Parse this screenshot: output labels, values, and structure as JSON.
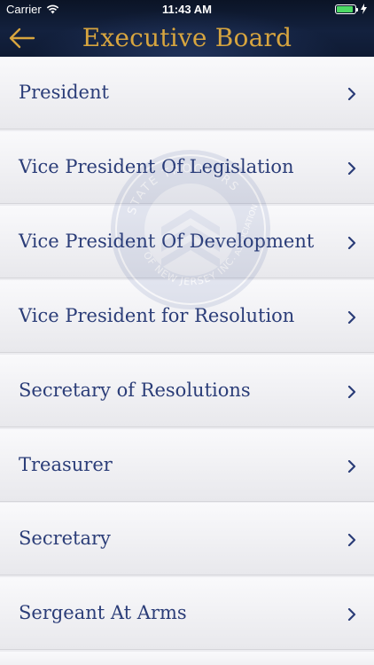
{
  "status_bar": {
    "carrier": "Carrier",
    "time": "11:43 AM"
  },
  "header": {
    "title": "Executive Board"
  },
  "seal_text": [
    "STATE TROOPERS",
    "ASSOCIATION",
    "OF NEW JERSEY INC."
  ],
  "list": {
    "items": [
      {
        "label": "President"
      },
      {
        "label": "Vice President Of Legislation"
      },
      {
        "label": "Vice President Of Development"
      },
      {
        "label": "Vice President for Resolution"
      },
      {
        "label": "Secretary of Resolutions"
      },
      {
        "label": "Treasurer"
      },
      {
        "label": "Secretary"
      },
      {
        "label": "Sergeant At Arms"
      }
    ]
  },
  "colors": {
    "header_bg": "#13213e",
    "title": "#d7a53f",
    "label": "#2b3d78",
    "chevron": "#2b3d78"
  }
}
